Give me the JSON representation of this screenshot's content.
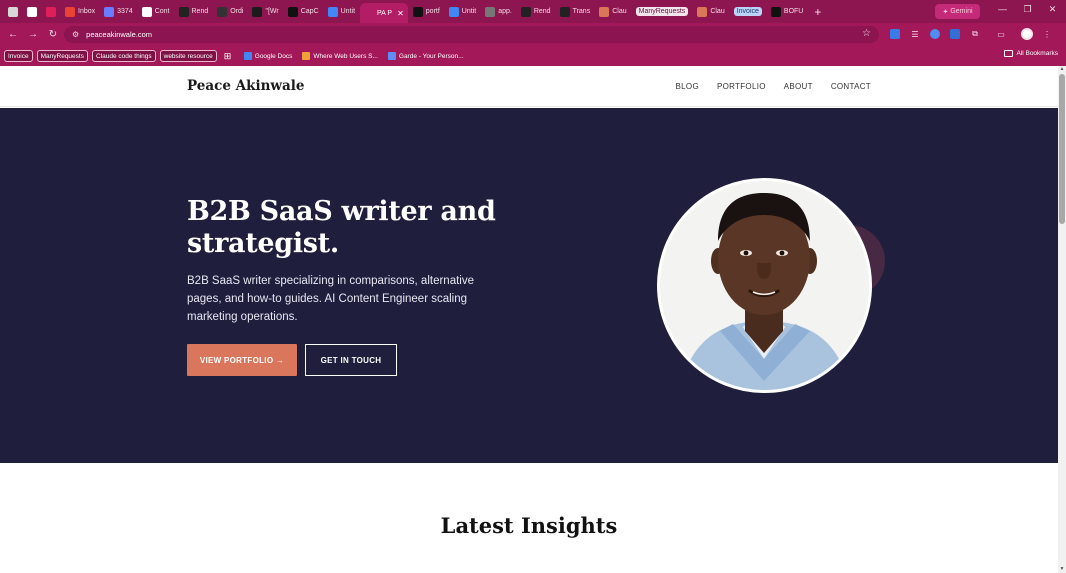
{
  "browser": {
    "tabs": [
      {
        "icon": "home-icon",
        "label": "",
        "color": "#d7d7d7"
      },
      {
        "icon": "chatgpt-icon",
        "label": "",
        "color": "#ffffff"
      },
      {
        "icon": "slack-icon",
        "label": "",
        "color": "#e01e5a"
      },
      {
        "icon": "gmail-icon",
        "label": "Inbox",
        "color": "#ea4335"
      },
      {
        "icon": "wave-icon",
        "label": "3374",
        "color": "#6b7cff"
      },
      {
        "icon": "notion-icon",
        "label": "Cont",
        "color": "#ffffff"
      },
      {
        "icon": "render-icon",
        "label": "Rend",
        "color": "#222222"
      },
      {
        "icon": "circle-icon",
        "label": "Ordi",
        "color": "#333333"
      },
      {
        "icon": "doc-icon",
        "label": "\"[Wr",
        "color": "#1b1b1b"
      },
      {
        "icon": "capcut-icon",
        "label": "CapC",
        "color": "#111111"
      },
      {
        "icon": "google-docs-icon",
        "label": "Untit",
        "color": "#4285f4"
      },
      {
        "icon": "pa-icon",
        "label": "PA P",
        "color": "#b21d66",
        "active": true
      },
      {
        "icon": "vercel-icon",
        "label": "portf",
        "color": "#111111"
      },
      {
        "icon": "google-docs-icon",
        "label": "Untit",
        "color": "#4285f4"
      },
      {
        "icon": "globe-icon",
        "label": "app.",
        "color": "#777777"
      },
      {
        "icon": "render-icon",
        "label": "Rend",
        "color": "#222222"
      },
      {
        "icon": "dot-icon",
        "label": "Trans",
        "color": "#222222"
      },
      {
        "icon": "claude-icon",
        "label": "Clau",
        "color": "#d97757"
      },
      {
        "icon": "pill",
        "label": "ManyRequests",
        "color": "#f2e6ec"
      },
      {
        "icon": "claude-icon",
        "label": "Clau",
        "color": "#d97757"
      },
      {
        "icon": "pill-blue",
        "label": "Invoice",
        "color": "#bcd3f7"
      },
      {
        "icon": "bolt-icon",
        "label": "BOFU",
        "color": "#111111"
      }
    ],
    "gemini_label": "Gemini",
    "url": "peaceakinwale.com",
    "bookmarks": [
      {
        "label": "Invoice",
        "boxed": true
      },
      {
        "label": "ManyRequests",
        "boxed": true
      },
      {
        "label": "Claude code things",
        "boxed": true
      },
      {
        "label": "website resource",
        "boxed": true
      },
      {
        "label": "",
        "icon": "apps-grid-icon"
      },
      {
        "label": "Google Docs",
        "icon": "google-docs-icon"
      },
      {
        "label": "Where Web Users S...",
        "icon": "bookmark-icon"
      },
      {
        "label": "Garde - Your Person...",
        "icon": "garde-icon"
      }
    ],
    "all_bookmarks": "All Bookmarks"
  },
  "site": {
    "brand": "Peace Akinwale",
    "nav": [
      "BLOG",
      "PORTFOLIO",
      "ABOUT",
      "CONTACT"
    ],
    "hero": {
      "title": "B2B SaaS writer and strategist.",
      "subtitle": "B2B SaaS writer specializing in comparisons, alternative pages, and how-to guides. AI Content Engineer scaling marketing operations.",
      "primary_cta": "VIEW PORTFOLIO →",
      "secondary_cta": "GET IN TOUCH"
    },
    "section_title": "Latest Insights"
  },
  "colors": {
    "browser_frame": "#8e1650",
    "hero_bg": "#1f1e3d",
    "accent": "#d9765b",
    "deco": "#4a2a44"
  }
}
